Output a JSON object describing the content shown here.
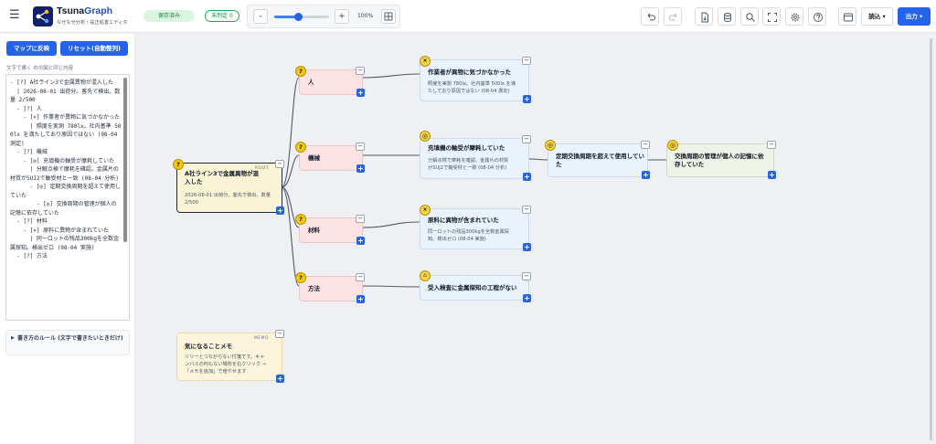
{
  "header": {
    "app_name_a": "Tsuna",
    "app_name_b": "Graph",
    "subtitle": "なぜなぜ分析・是正処置エディタ",
    "status_saved": "保存済み",
    "status_undecided": "未判定 0",
    "zoom_minus": "-",
    "zoom_plus": "+",
    "zoom_value": "100%",
    "zoom_level_percent": 100,
    "read_menu": "読込 ▾",
    "export_menu": "出力 ▾"
  },
  "sidebar": {
    "apply_button": "マップに反映",
    "reset_button": "リセット(自動整列)",
    "hint": "文字で書く  右の図と同じ内容",
    "editor_text": "- [?] A社ライン3で金属異物が混入した\n  | 2026-08-01 出荷分。客先で検出。数量 2/500\n  - [?] 人\n    - [×] 作業者が異物に気づかなかった\n      | 照度を実測 780lx。社内基準 500lx を満たしており原因ではない (08-04 測定)\n  - [?] 機械\n    - [◎] 充填機の軸受が摩耗していた\n      | 分解点検で摩耗を確認。金属片の材質がSUJ2で軸受材と一致 (08-04 分析)\n      - [◎] 定期交換周期を超えて使用していた\n        - [◎] 交換周期の管理が個人の記憶に依存していた\n  - [?] 材料\n    - [×] 原料に異物が含まれていた\n      | 同一ロットの残品300kgを全数金属探知。検出ゼロ (08-04 実施)\n  - [?] 方法",
    "rules_label": "書き方のルール (文字で書きたいときだけ)"
  },
  "nodes": {
    "root": {
      "tag": "ROOT",
      "title_l1": "A社ライン3で金属異物が混",
      "title_l2": "入した",
      "desc_l1": "2026-08-01 出荷分。客先で検出。数量",
      "desc_l2": "2/500",
      "badge": "?"
    },
    "human": {
      "title": "人",
      "badge": "?"
    },
    "machine": {
      "title": "機械",
      "badge": "?"
    },
    "material": {
      "title": "材料",
      "badge": "?"
    },
    "method": {
      "title": "方法",
      "badge": "?"
    },
    "worker": {
      "title": "作業者が異物に気づかなかった",
      "desc_l1": "照度を実測 780lx。社内基準 500lx を満",
      "desc_l2": "たしており原因ではない (08-04 測定)",
      "badge": "×"
    },
    "bearing": {
      "title": "充填機の軸受が摩耗していた",
      "desc_l1": "分解点検で摩耗を確認。金属片の材質",
      "desc_l2": "がSUJ2で軸受材と一致 (08-04 分析)",
      "badge": "◎"
    },
    "cycle": {
      "title_l1": "定期交換周期を超えて使用してい",
      "title_l2": "た",
      "badge": "◎"
    },
    "person_memory": {
      "title_l1": "交換周期の管理が個人の記憶に依",
      "title_l2": "存していた",
      "badge": "◎"
    },
    "raw_material": {
      "title": "原料に異物が含まれていた",
      "desc_l1": "同一ロットの残品300kgを全数金属探",
      "desc_l2": "知。検出ゼロ (08-04 実施)",
      "badge": "×"
    },
    "inspection": {
      "title": "受入検査に金属探知の工程がない",
      "badge": "⚠"
    },
    "memo": {
      "tag": "MEMO",
      "title": "気になることメモ",
      "desc_l1": "ツリーとつながらない付箋です。キャ",
      "desc_l2": "ンバスの何もない場所を右クリック →",
      "desc_l3": "「メモを追加」で増やせます"
    }
  },
  "node_controls": {
    "collapse": "−",
    "add": "+"
  },
  "colors": {
    "accent": "#2563eb",
    "cause_fill": "#fbe3e3",
    "fact_fill": "#eaf3fc",
    "root_fill": "#fbf3d5",
    "memo_fill": "#fcf5dc",
    "conclusion_fill": "#edf3e6",
    "badge_yellow": "#f2c811",
    "saved_green": "#15803d"
  },
  "icons": [
    "menu-icon",
    "logo-icon",
    "grid-icon",
    "undo-icon",
    "redo-icon",
    "export-file-icon",
    "database-icon",
    "search-icon",
    "fit-screen-icon",
    "gear-icon",
    "help-icon",
    "panel-icon"
  ]
}
